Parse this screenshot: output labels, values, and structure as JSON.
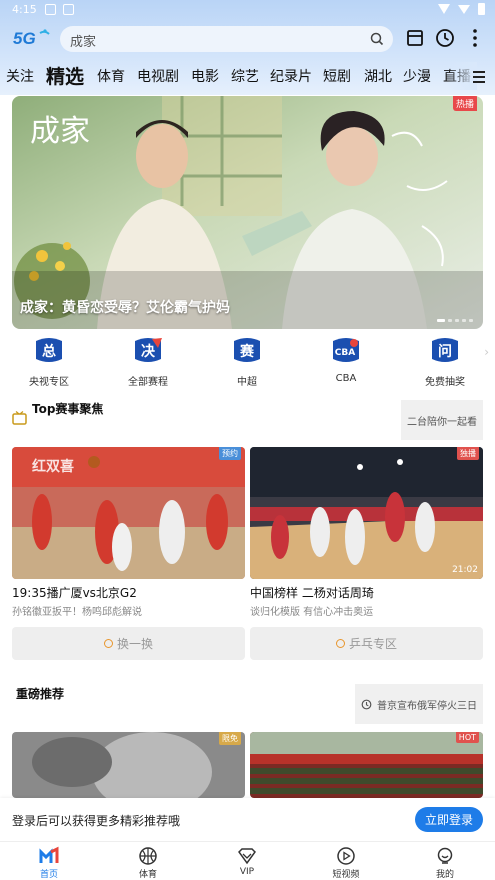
{
  "status_bar": {
    "time": "4:15"
  },
  "header": {
    "logo_text": "5G",
    "search": {
      "placeholder": "成家"
    }
  },
  "nav": {
    "items": [
      "关注",
      "精选",
      "体育",
      "电视剧",
      "电影",
      "综艺",
      "纪录片",
      "短剧",
      "湖北",
      "少漫",
      "直播"
    ],
    "active": "精选"
  },
  "banner": {
    "title": "成家：黄昏恋受辱？艾伦霸气护妈",
    "badge": "热播",
    "logo_text": "成家",
    "page_count": 5,
    "page_index": 0
  },
  "quick_links": [
    {
      "label": "央视专区",
      "icon": "cctv-sports-icon",
      "glyph": "总"
    },
    {
      "label": "全部赛程",
      "icon": "schedule-icon",
      "glyph": "决"
    },
    {
      "label": "中超",
      "icon": "csl-icon",
      "glyph": "赛"
    },
    {
      "label": "CBA",
      "icon": "cba-icon",
      "glyph": "CBA"
    },
    {
      "label": "免费抽奖",
      "icon": "lottery-icon",
      "glyph": "问"
    }
  ],
  "top_events": {
    "title": "Top赛事聚焦",
    "side_pill": "二台陪你一起看",
    "cards": [
      {
        "title": "19:35播广厦vs北京G2",
        "subtitle": "孙铭徽亚扳平！杨鸣邱彪解说",
        "tag": "预约",
        "duration": ""
      },
      {
        "title": "中国榜样 二杨对话周琦",
        "subtitle": "谈归化模版 有信心冲击奥运",
        "tag": "独播",
        "duration": "21:02"
      }
    ],
    "refresh_label": "换一换",
    "zone_label": "乒乓专区"
  },
  "featured": {
    "title": "重磅推荐",
    "side_pill": "普京宣布俄军停火三日",
    "cards": [
      {
        "tag": "限免"
      },
      {
        "tag": "HOT"
      }
    ]
  },
  "login_prompt": {
    "text": "登录后可以获得更多精彩推荐哦",
    "button": "立即登录"
  },
  "tabbar": [
    {
      "label": "首页",
      "icon": "home-icon"
    },
    {
      "label": "体育",
      "icon": "basketball-icon"
    },
    {
      "label": "VIP",
      "icon": "vip-diamond-icon"
    },
    {
      "label": "短视频",
      "icon": "play-icon"
    },
    {
      "label": "我的",
      "icon": "profile-icon"
    }
  ],
  "colors": {
    "accent": "#1e7ce8",
    "header_bg": "#c7dcf8",
    "tag_red": "#e0524e"
  }
}
